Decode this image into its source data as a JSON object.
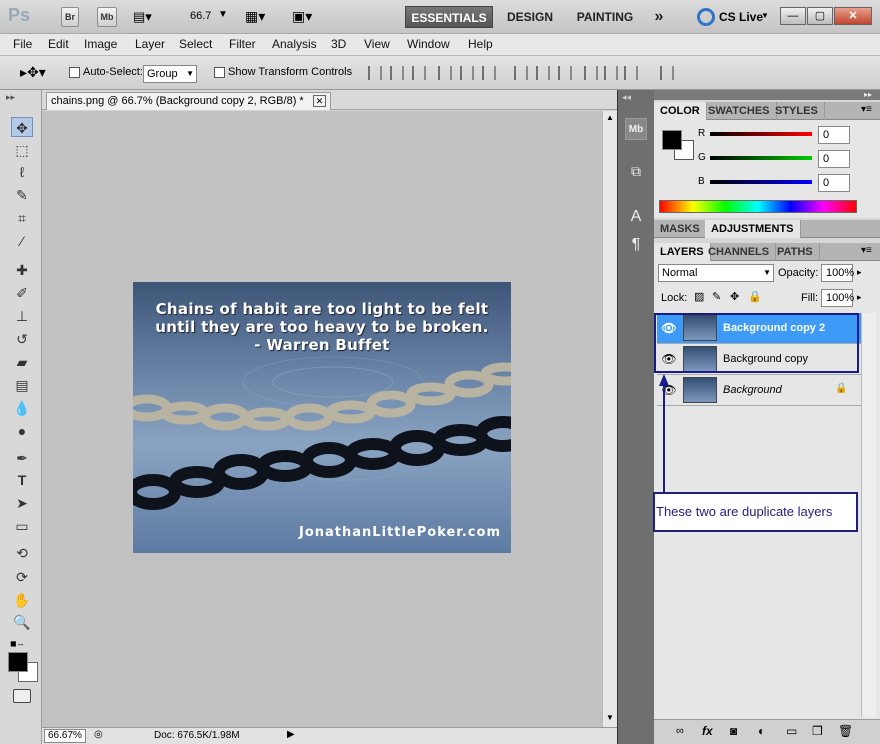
{
  "titlebar": {
    "logo": "Ps",
    "br": "Br",
    "mb": "Mb",
    "zoom": "66.7",
    "workspaces": [
      "ESSENTIALS",
      "DESIGN",
      "PAINTING"
    ],
    "more": "»",
    "cslive": "CS Live",
    "min": "—",
    "max": "▢",
    "close": "✕"
  },
  "menu": [
    "File",
    "Edit",
    "Image",
    "Layer",
    "Select",
    "Filter",
    "Analysis",
    "3D",
    "View",
    "Window",
    "Help"
  ],
  "options": {
    "auto_select": "Auto-Select:",
    "auto_select_value": "Group",
    "show_transform": "Show Transform Controls"
  },
  "document": {
    "tab_title": "chains.png @ 66.7% (Background copy 2, RGB/8) *",
    "quote_line1": "Chains of habit are too light to be felt",
    "quote_line2": "until they are too heavy to be broken.",
    "quote_line3": "- Warren Buffet",
    "watermark": "JonathanLittlePoker.com"
  },
  "status": {
    "zoom": "66.67%",
    "doc": "Doc: 676.5K/1.98M"
  },
  "color_panel": {
    "tabs": [
      "COLOR",
      "SWATCHES",
      "STYLES"
    ],
    "r_label": "R",
    "g_label": "G",
    "b_label": "B",
    "r": "0",
    "g": "0",
    "b": "0"
  },
  "adjust_tabs": [
    "MASKS",
    "ADJUSTMENTS"
  ],
  "layers_panel": {
    "tabs": [
      "LAYERS",
      "CHANNELS",
      "PATHS"
    ],
    "blend_mode": "Normal",
    "opacity_label": "Opacity:",
    "opacity": "100%",
    "lock_label": "Lock:",
    "fill_label": "Fill:",
    "fill": "100%",
    "layers": [
      "Background copy 2",
      "Background copy",
      "Background"
    ]
  },
  "annotation": "These two are duplicate layers",
  "colors": {
    "selected_layer": "#3d9bf7",
    "annotation": "#1f1f7e"
  }
}
